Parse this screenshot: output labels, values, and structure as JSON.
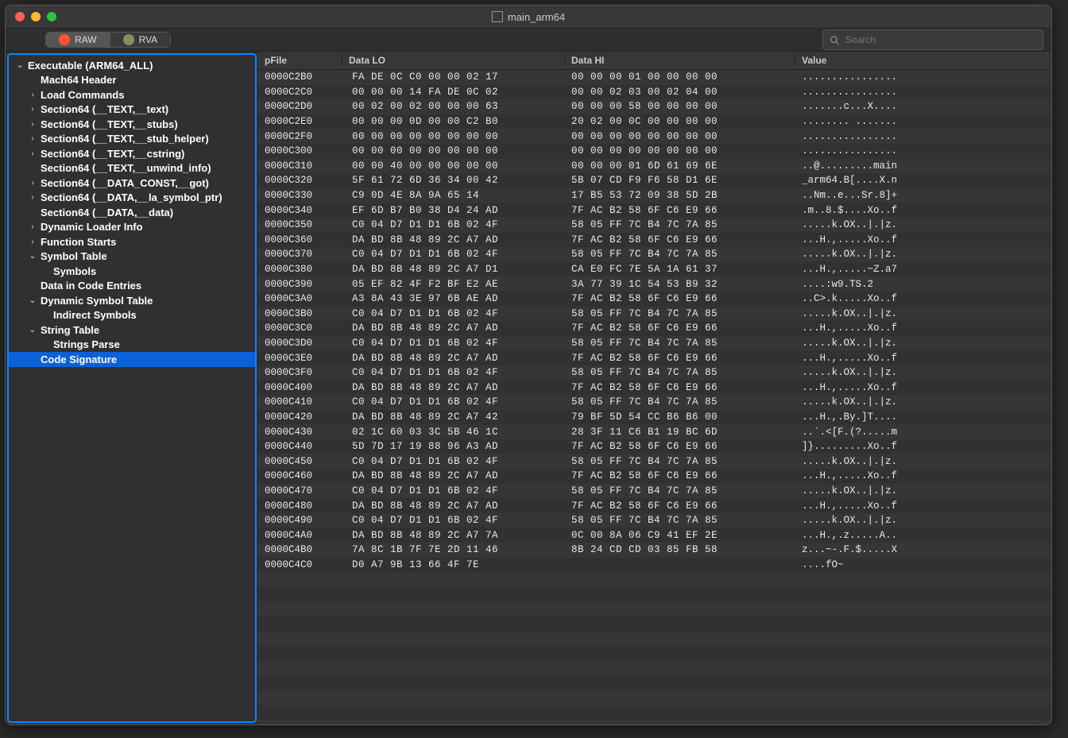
{
  "window_title": "main_arm64",
  "traffic": {
    "close": "#ff5f57",
    "min": "#febc2e",
    "max": "#28c840"
  },
  "toolbar": {
    "raw_label": "RAW",
    "rva_label": "RVA",
    "raw_icon_color": "#ff5533",
    "rva_icon_color": "#8b8b60"
  },
  "search": {
    "placeholder": "Search"
  },
  "columns": {
    "pfile": "pFile",
    "lo": "Data LO",
    "hi": "Data HI",
    "val": "Value"
  },
  "tree": [
    {
      "l": 0,
      "caret": "v",
      "label": "Executable  (ARM64_ALL)"
    },
    {
      "l": 1,
      "caret": "",
      "label": "Mach64 Header"
    },
    {
      "l": 1,
      "caret": ">",
      "label": "Load Commands"
    },
    {
      "l": 1,
      "caret": ">",
      "label": "Section64 (__TEXT,__text)"
    },
    {
      "l": 1,
      "caret": ">",
      "label": "Section64 (__TEXT,__stubs)"
    },
    {
      "l": 1,
      "caret": ">",
      "label": "Section64 (__TEXT,__stub_helper)"
    },
    {
      "l": 1,
      "caret": ">",
      "label": "Section64 (__TEXT,__cstring)"
    },
    {
      "l": 1,
      "caret": "",
      "label": "Section64 (__TEXT,__unwind_info)"
    },
    {
      "l": 1,
      "caret": ">",
      "label": "Section64 (__DATA_CONST,__got)"
    },
    {
      "l": 1,
      "caret": ">",
      "label": "Section64 (__DATA,__la_symbol_ptr)"
    },
    {
      "l": 1,
      "caret": "",
      "label": "Section64 (__DATA,__data)"
    },
    {
      "l": 1,
      "caret": ">",
      "label": "Dynamic Loader Info"
    },
    {
      "l": 1,
      "caret": ">",
      "label": "Function Starts"
    },
    {
      "l": 1,
      "caret": "v",
      "label": "Symbol Table"
    },
    {
      "l": 2,
      "caret": "",
      "label": "Symbols"
    },
    {
      "l": 1,
      "caret": "",
      "label": "Data in Code Entries"
    },
    {
      "l": 1,
      "caret": "v",
      "label": "Dynamic Symbol Table"
    },
    {
      "l": 2,
      "caret": "",
      "label": "Indirect Symbols"
    },
    {
      "l": 1,
      "caret": "v",
      "label": "String Table"
    },
    {
      "l": 2,
      "caret": "",
      "label": "Strings Parse"
    },
    {
      "l": 1,
      "caret": "",
      "label": "Code Signature",
      "sel": true
    }
  ],
  "rows": [
    {
      "p": "0000C2B0",
      "lo": "FA DE 0C C0 00 00 02 17",
      "hi": "00 00 00 01 00 00 00 00",
      "v": "................"
    },
    {
      "p": "0000C2C0",
      "lo": "00 00 00 14 FA DE 0C 02",
      "hi": "00 00 02 03 00 02 04 00",
      "v": "................"
    },
    {
      "p": "0000C2D0",
      "lo": "00 02 00 02 00 00 00 63",
      "hi": "00 00 00 58 00 00 00 00",
      "v": ".......c...X...."
    },
    {
      "p": "0000C2E0",
      "lo": "00 00 00 0D 00 00 C2 B0",
      "hi": "20 02 00 0C 00 00 00 00",
      "v": "........ ......."
    },
    {
      "p": "0000C2F0",
      "lo": "00 00 00 00 00 00 00 00",
      "hi": "00 00 00 00 00 00 00 00",
      "v": "................"
    },
    {
      "p": "0000C300",
      "lo": "00 00 00 00 00 00 00 00",
      "hi": "00 00 00 00 00 00 00 00",
      "v": "................"
    },
    {
      "p": "0000C310",
      "lo": "00 00 40 00 00 00 00 00",
      "hi": "00 00 00 01 6D 61 69 6E",
      "v": "..@.........main"
    },
    {
      "p": "0000C320",
      "lo": "5F 61 72 6D 36 34 00 42",
      "hi": "5B 07 CD F9 F6 58 D1 6E",
      "v": "_arm64.B[....X.n"
    },
    {
      "p": "0000C330",
      "lo": "C9 0D 4E 8A 9A 65 14",
      "hi": "17 B5 53 72 09 38 5D 2B",
      "v": "..Nm..e...Sr.8]+"
    },
    {
      "p": "0000C340",
      "lo": "EF 6D B7 B0 38 D4 24 AD",
      "hi": "7F AC B2 58 6F C6 E9 66",
      "v": ".m..8.$....Xo..f"
    },
    {
      "p": "0000C350",
      "lo": "C0 04 D7 D1 D1 6B 02 4F",
      "hi": "58 05 FF 7C B4 7C 7A 85",
      "v": ".....k.OX..|.|z."
    },
    {
      "p": "0000C360",
      "lo": "DA BD 8B 48 89 2C A7 AD",
      "hi": "7F AC B2 58 6F C6 E9 66",
      "v": "...H.,.....Xo..f"
    },
    {
      "p": "0000C370",
      "lo": "C0 04 D7 D1 D1 6B 02 4F",
      "hi": "58 05 FF 7C B4 7C 7A 85",
      "v": ".....k.OX..|.|z."
    },
    {
      "p": "0000C380",
      "lo": "DA BD 8B 48 89 2C A7 D1",
      "hi": "CA E0 FC 7E 5A 1A 61 37",
      "v": "...H.,.....~Z.a7"
    },
    {
      "p": "0000C390",
      "lo": "05 EF 82 4F F2 BF E2 AE",
      "hi": "3A 77 39 1C 54 53 B9 32",
      "v": "....:w9.TS.2"
    },
    {
      "p": "0000C3A0",
      "lo": "A3 8A 43 3E 97 6B AE AD",
      "hi": "7F AC B2 58 6F C6 E9 66",
      "v": "..C>.k.....Xo..f"
    },
    {
      "p": "0000C3B0",
      "lo": "C0 04 D7 D1 D1 6B 02 4F",
      "hi": "58 05 FF 7C B4 7C 7A 85",
      "v": ".....k.OX..|.|z."
    },
    {
      "p": "0000C3C0",
      "lo": "DA BD 8B 48 89 2C A7 AD",
      "hi": "7F AC B2 58 6F C6 E9 66",
      "v": "...H.,.....Xo..f"
    },
    {
      "p": "0000C3D0",
      "lo": "C0 04 D7 D1 D1 6B 02 4F",
      "hi": "58 05 FF 7C B4 7C 7A 85",
      "v": ".....k.OX..|.|z."
    },
    {
      "p": "0000C3E0",
      "lo": "DA BD 8B 48 89 2C A7 AD",
      "hi": "7F AC B2 58 6F C6 E9 66",
      "v": "...H.,.....Xo..f"
    },
    {
      "p": "0000C3F0",
      "lo": "C0 04 D7 D1 D1 6B 02 4F",
      "hi": "58 05 FF 7C B4 7C 7A 85",
      "v": ".....k.OX..|.|z."
    },
    {
      "p": "0000C400",
      "lo": "DA BD 8B 48 89 2C A7 AD",
      "hi": "7F AC B2 58 6F C6 E9 66",
      "v": "...H.,.....Xo..f"
    },
    {
      "p": "0000C410",
      "lo": "C0 04 D7 D1 D1 6B 02 4F",
      "hi": "58 05 FF 7C B4 7C 7A 85",
      "v": ".....k.OX..|.|z."
    },
    {
      "p": "0000C420",
      "lo": "DA BD 8B 48 89 2C A7 42",
      "hi": "79 BF 5D 54 CC B6 B6 00",
      "v": "...H.,.By.]T...."
    },
    {
      "p": "0000C430",
      "lo": "02 1C 60 03 3C 5B 46 1C",
      "hi": "28 3F 11 C6 B1 19 BC 6D",
      "v": "..`.<[F.(?.....m"
    },
    {
      "p": "0000C440",
      "lo": "5D 7D 17 19 88 96 A3 AD",
      "hi": "7F AC B2 58 6F C6 E9 66",
      "v": "]}.........Xo..f"
    },
    {
      "p": "0000C450",
      "lo": "C0 04 D7 D1 D1 6B 02 4F",
      "hi": "58 05 FF 7C B4 7C 7A 85",
      "v": ".....k.OX..|.|z."
    },
    {
      "p": "0000C460",
      "lo": "DA BD 8B 48 89 2C A7 AD",
      "hi": "7F AC B2 58 6F C6 E9 66",
      "v": "...H.,.....Xo..f"
    },
    {
      "p": "0000C470",
      "lo": "C0 04 D7 D1 D1 6B 02 4F",
      "hi": "58 05 FF 7C B4 7C 7A 85",
      "v": ".....k.OX..|.|z."
    },
    {
      "p": "0000C480",
      "lo": "DA BD 8B 48 89 2C A7 AD",
      "hi": "7F AC B2 58 6F C6 E9 66",
      "v": "...H.,.....Xo..f"
    },
    {
      "p": "0000C490",
      "lo": "C0 04 D7 D1 D1 6B 02 4F",
      "hi": "58 05 FF 7C B4 7C 7A 85",
      "v": ".....k.OX..|.|z."
    },
    {
      "p": "0000C4A0",
      "lo": "DA BD 8B 48 89 2C A7 7A",
      "hi": "0C 00 8A 06 C9 41 EF 2E",
      "v": "...H.,.z.....A.."
    },
    {
      "p": "0000C4B0",
      "lo": "7A 8C 1B 7F 7E 2D 11 46",
      "hi": "8B 24 CD CD 03 85 FB 58",
      "v": "z...~-.F.$.....X"
    },
    {
      "p": "0000C4C0",
      "lo": "D0 A7 9B 13 66 4F 7E",
      "hi": "",
      "v": "....fO~"
    }
  ]
}
